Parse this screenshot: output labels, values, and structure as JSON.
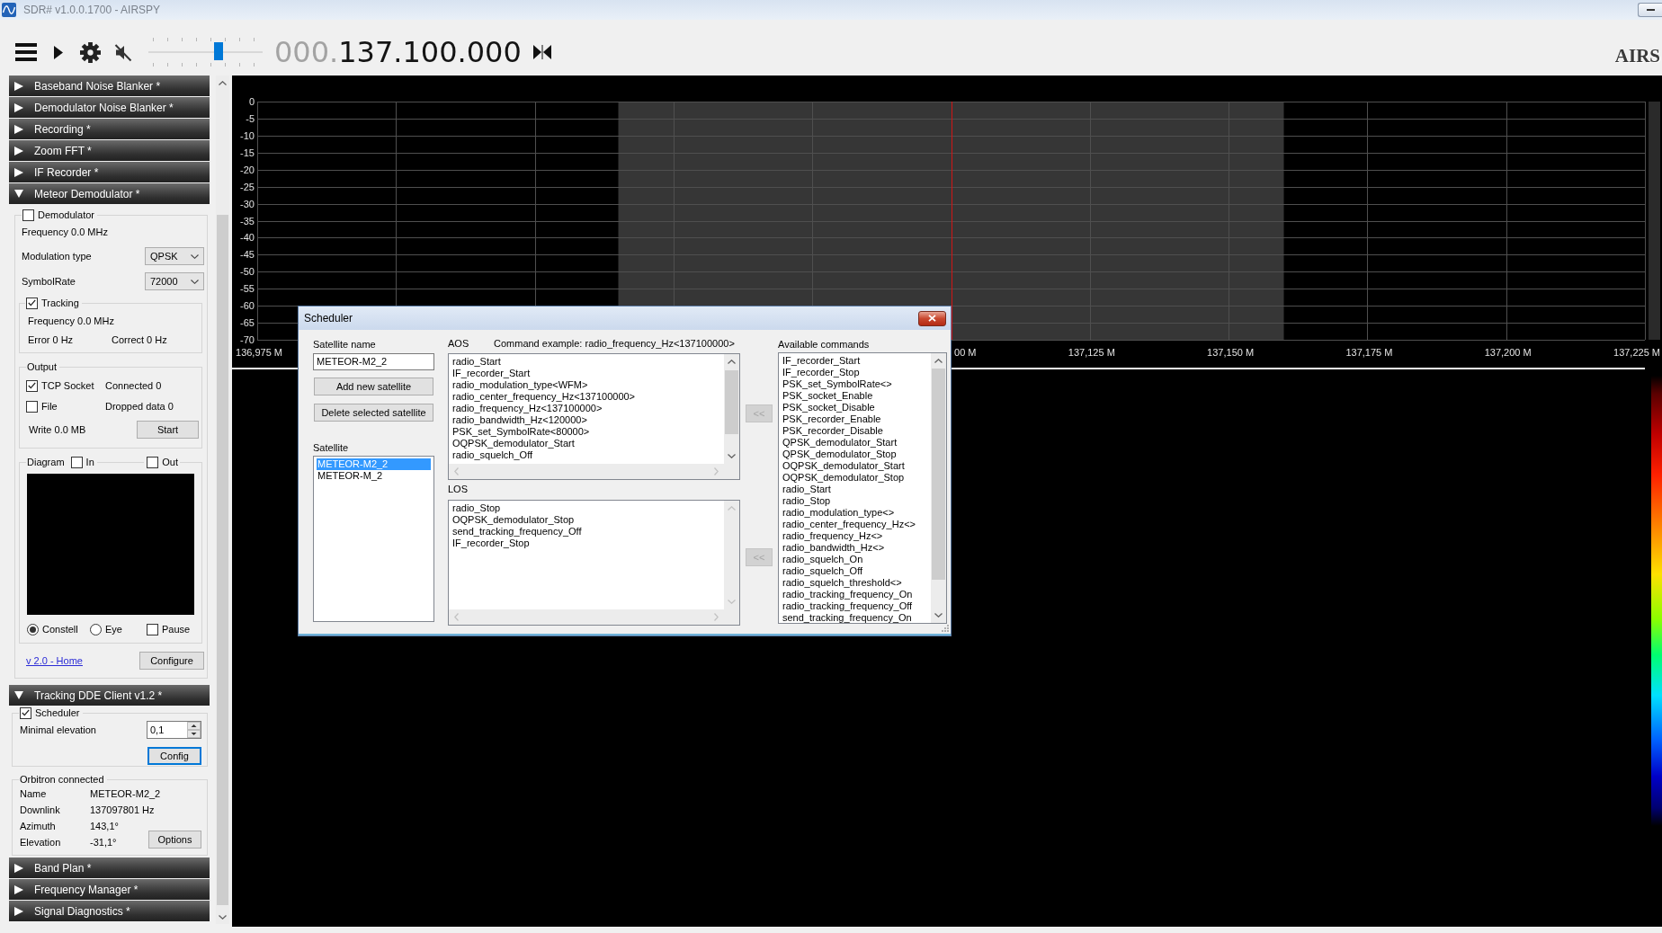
{
  "window": {
    "title": "SDR# v1.0.0.1700 - AIRSPY"
  },
  "toolbar": {
    "volume": {
      "level": 0.62
    },
    "frequency": {
      "dim": "000.",
      "value": "137.100.000"
    },
    "logo": "AIRS"
  },
  "sidebar": {
    "panels": [
      {
        "title": "Baseband Noise Blanker *",
        "expanded": false
      },
      {
        "title": "Demodulator Noise Blanker *",
        "expanded": false
      },
      {
        "title": "Recording *",
        "expanded": false
      },
      {
        "title": "Zoom FFT *",
        "expanded": false
      },
      {
        "title": "IF Recorder *",
        "expanded": false
      },
      {
        "title": "Meteor Demodulator *",
        "expanded": true,
        "body": {
          "kind": "meteor",
          "demodulator": {
            "label": "Demodulator",
            "checked": false
          },
          "frequency": "Frequency 0.0 MHz",
          "modulation": {
            "label": "Modulation type",
            "value": "QPSK"
          },
          "symbol_rate": {
            "label": "SymbolRate",
            "value": "72000"
          },
          "tracking": {
            "label": "Tracking",
            "checked": true,
            "frequency": "Frequency 0.0 MHz",
            "error": "Error 0 Hz",
            "correct": "Correct 0 Hz"
          },
          "output": {
            "title": "Output",
            "tcp_socket": {
              "label": "TCP Socket",
              "checked": true
            },
            "connected": "Connected 0",
            "file": {
              "label": "File",
              "checked": false
            },
            "dropped": "Dropped data 0",
            "written": "Write 0.0 MB",
            "button": "Start"
          },
          "diagram": {
            "title": "Diagram",
            "input": {
              "label": "In",
              "checked": false
            },
            "output": {
              "label": "Out",
              "checked": false
            },
            "modes": [
              {
                "label": "Constell",
                "selected": true
              },
              {
                "label": "Eye",
                "selected": false
              }
            ],
            "pause": {
              "label": "Pause",
              "checked": false
            }
          },
          "link": "v 2.0 - Home",
          "button": "Configure"
        }
      },
      {
        "title": "Tracking DDE Client v1.2 *",
        "expanded": true,
        "body": {
          "kind": "tracking",
          "scheduler": {
            "label": "Scheduler",
            "checked": true
          },
          "min_elevation": {
            "label": "Minimal elevation",
            "value": "0,1"
          },
          "config": {
            "label": "Config",
            "focused": true
          },
          "orbitron": {
            "title": "Orbitron connected",
            "rows": [
              {
                "label": "Name",
                "value": "METEOR-M2_2"
              },
              {
                "label": "Downlink",
                "value": "137097801 Hz"
              },
              {
                "label": "Azimuth",
                "value": "143,1°"
              },
              {
                "label": "Elevation",
                "value": "-31,1°"
              }
            ],
            "button": "Options"
          }
        }
      },
      {
        "title": "Band Plan *",
        "expanded": false
      },
      {
        "title": "Frequency Manager *",
        "expanded": false
      },
      {
        "title": "Signal Diagnostics *",
        "expanded": false
      }
    ]
  },
  "spectrum": {
    "y_labels": [
      "0",
      "-5",
      "-10",
      "-15",
      "-20",
      "-25",
      "-30",
      "-35",
      "-40",
      "-45",
      "-50",
      "-55",
      "-60",
      "-65",
      "-70"
    ],
    "x_labels": [
      "136,975 M",
      "00 M",
      "137,125 M",
      "137,150 M",
      "137,175 M",
      "137,200 M",
      "137,225 M"
    ]
  },
  "scheduler": {
    "title": "Scheduler",
    "satellite_name": {
      "label": "Satellite name",
      "value": "METEOR-M2_2"
    },
    "buttons": [
      "Add new satellite",
      "Delete selected satellite"
    ],
    "satellites": {
      "label": "Satellite",
      "items": [
        {
          "name": "METEOR-M2_2",
          "selected": true
        },
        {
          "name": "METEOR-M_2",
          "selected": false
        }
      ]
    },
    "aos": {
      "label": "AOS",
      "hint": "Command example: radio_frequency_Hz<137100000>",
      "scrollable": true,
      "items": [
        "radio_Start",
        "IF_recorder_Start",
        "radio_modulation_type<WFM>",
        "radio_center_frequency_Hz<137100000>",
        "radio_frequency_Hz<137100000>",
        "radio_bandwidth_Hz<120000>",
        "PSK_set_SymbolRate<80000>",
        "OQPSK_demodulator_Start",
        "radio_squelch_Off"
      ]
    },
    "los": {
      "label": "LOS",
      "scrollable": false,
      "items": [
        "radio_Stop",
        "OQPSK_demodulator_Stop",
        "send_tracking_frequency_Off",
        "IF_recorder_Stop"
      ]
    },
    "move_buttons": [
      {
        "label": "<<",
        "disabled": true
      },
      {
        "label": "<<",
        "disabled": true
      }
    ],
    "available": {
      "label": "Available commands",
      "scrollable": true,
      "items": [
        "IF_recorder_Start",
        "IF_recorder_Stop",
        "PSK_set_SymbolRate<>",
        "PSK_socket_Enable",
        "PSK_socket_Disable",
        "PSK_recorder_Enable",
        "PSK_recorder_Disable",
        "QPSK_demodulator_Start",
        "QPSK_demodulator_Stop",
        "OQPSK_demodulator_Start",
        "OQPSK_demodulator_Stop",
        "radio_Start",
        "radio_Stop",
        "radio_modulation_type<>",
        "radio_center_frequency_Hz<>",
        "radio_frequency_Hz<>",
        "radio_bandwidth_Hz<>",
        "radio_squelch_On",
        "radio_squelch_Off",
        "radio_squelch_threshold<>",
        "radio_tracking_frequency_On",
        "radio_tracking_frequency_Off",
        "send_tracking_frequency_On"
      ]
    }
  }
}
